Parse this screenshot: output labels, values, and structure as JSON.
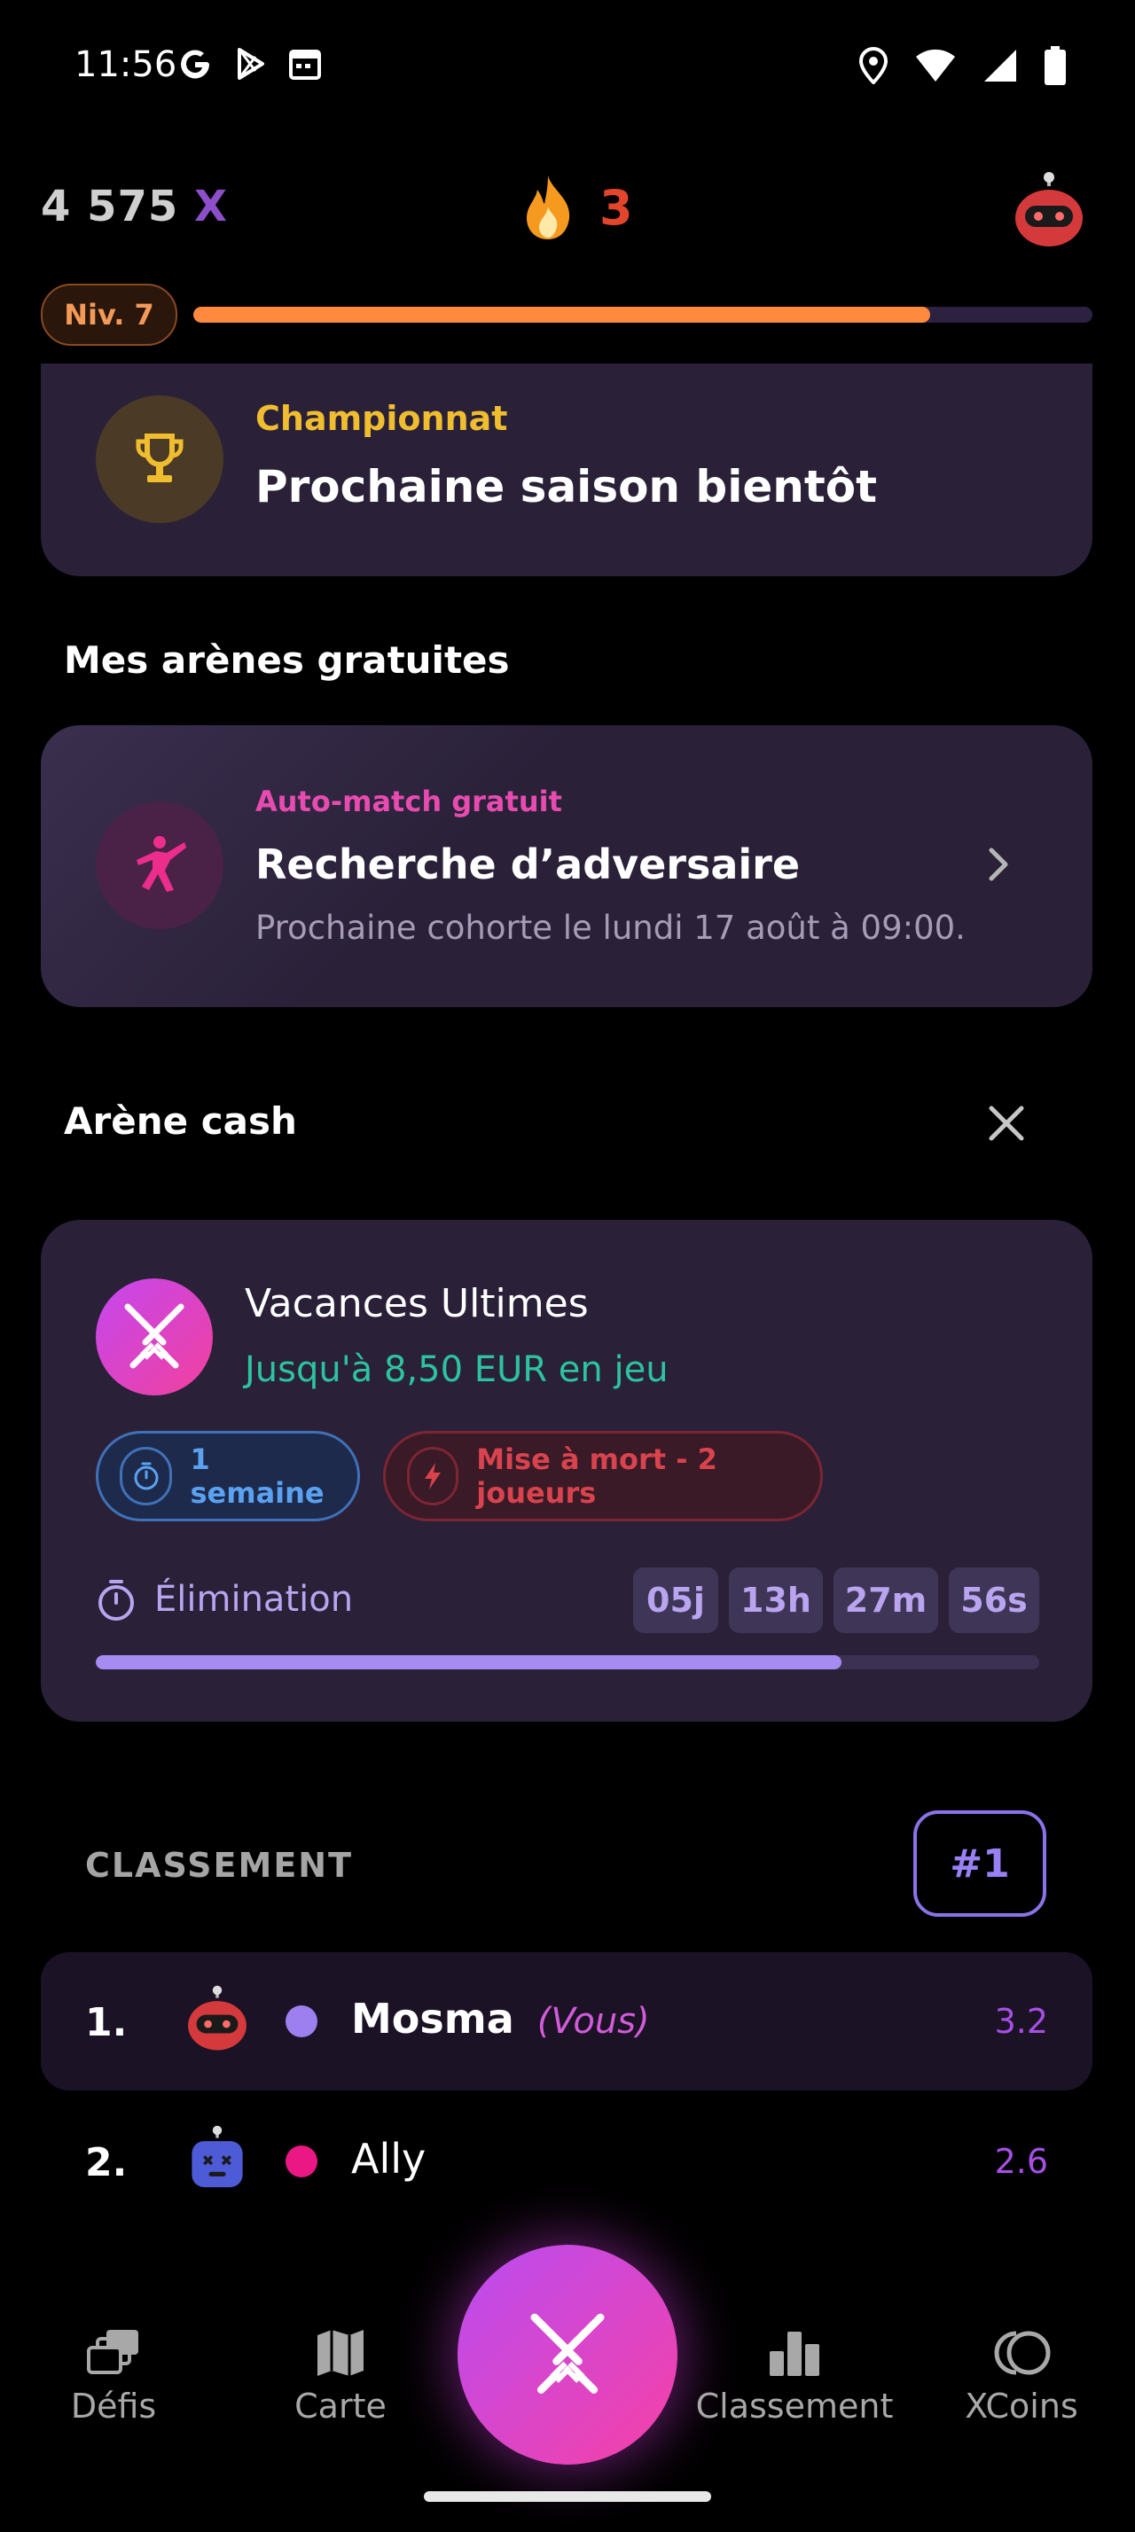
{
  "status_bar": {
    "time": "11:56"
  },
  "header": {
    "xp": "4 575",
    "xp_suffix": "X",
    "streak": "3",
    "level_label": "Niv. 7",
    "level_progress": 0.82
  },
  "championship": {
    "subtitle": "Championnat",
    "title": "Prochaine saison bientôt"
  },
  "free_arenas": {
    "heading": "Mes arènes gratuites",
    "card": {
      "subtitle": "Auto-match gratuit",
      "title": "Recherche d’adversaire",
      "description": "Prochaine cohorte le lundi 17 août à 09:00."
    }
  },
  "cash_arena": {
    "heading": "Arène cash",
    "card": {
      "title": "Vacances Ultimes",
      "subtitle": "Jusqu'à 8,50 EUR en jeu",
      "chip_duration": "1 semaine",
      "chip_mode": "Mise à mort - 2 joueurs",
      "elimination_label": "Élimination",
      "timer": [
        "05j",
        "13h",
        "27m",
        "56s"
      ],
      "progress": 0.79
    }
  },
  "ranking": {
    "heading": "CLASSEMENT",
    "badge": "#1",
    "rows": [
      {
        "position": "1.",
        "name": "Mosma",
        "you": "(Vous)",
        "score": "3.2",
        "dot_color": "#9d7ff0",
        "avatar_color": "#d4393c"
      },
      {
        "position": "2.",
        "name": "Ally",
        "you": "",
        "score": "2.6",
        "dot_color": "#ea1784",
        "avatar_color": "#4e5bd6"
      }
    ]
  },
  "bottom_nav": {
    "items": [
      {
        "label": "Défis",
        "icon": "cards-icon"
      },
      {
        "label": "Carte",
        "icon": "map-icon"
      },
      {
        "label": "Classement",
        "icon": "bar-chart-icon"
      },
      {
        "label": "XCoins",
        "icon": "coins-icon"
      }
    ],
    "center_icon": "crossed-swords-icon"
  }
}
